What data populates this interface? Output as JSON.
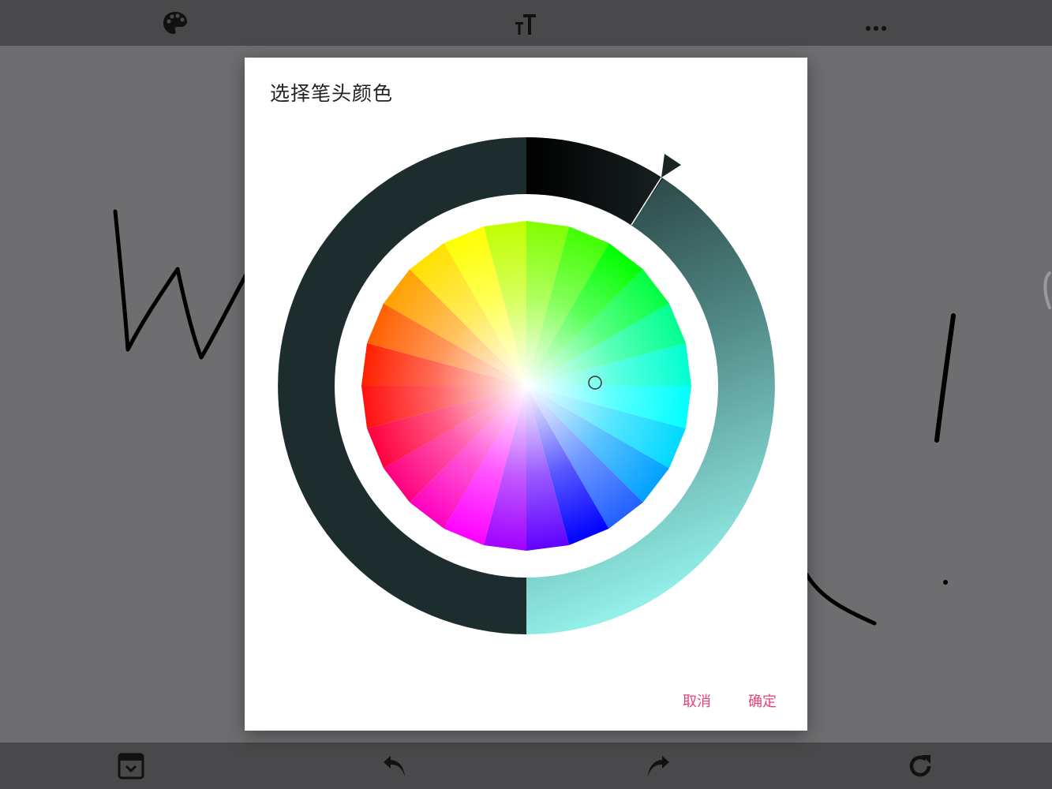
{
  "dialog": {
    "title": "选择笔头颜色",
    "cancel_label": "取消",
    "confirm_label": "确定"
  },
  "toolbar_top": {
    "icons": [
      "palette-icon",
      "text-size-icon",
      "more-icon"
    ]
  },
  "toolbar_bottom": {
    "icons": [
      "collapse-icon",
      "undo-icon",
      "redo-icon",
      "refresh-icon"
    ]
  },
  "colors": {
    "accent": "#e8407a",
    "selected_dark": "#1d2d2e",
    "toolbar": "#49484a",
    "canvas": "#6e6d70",
    "ring_light": "#90ede6"
  }
}
